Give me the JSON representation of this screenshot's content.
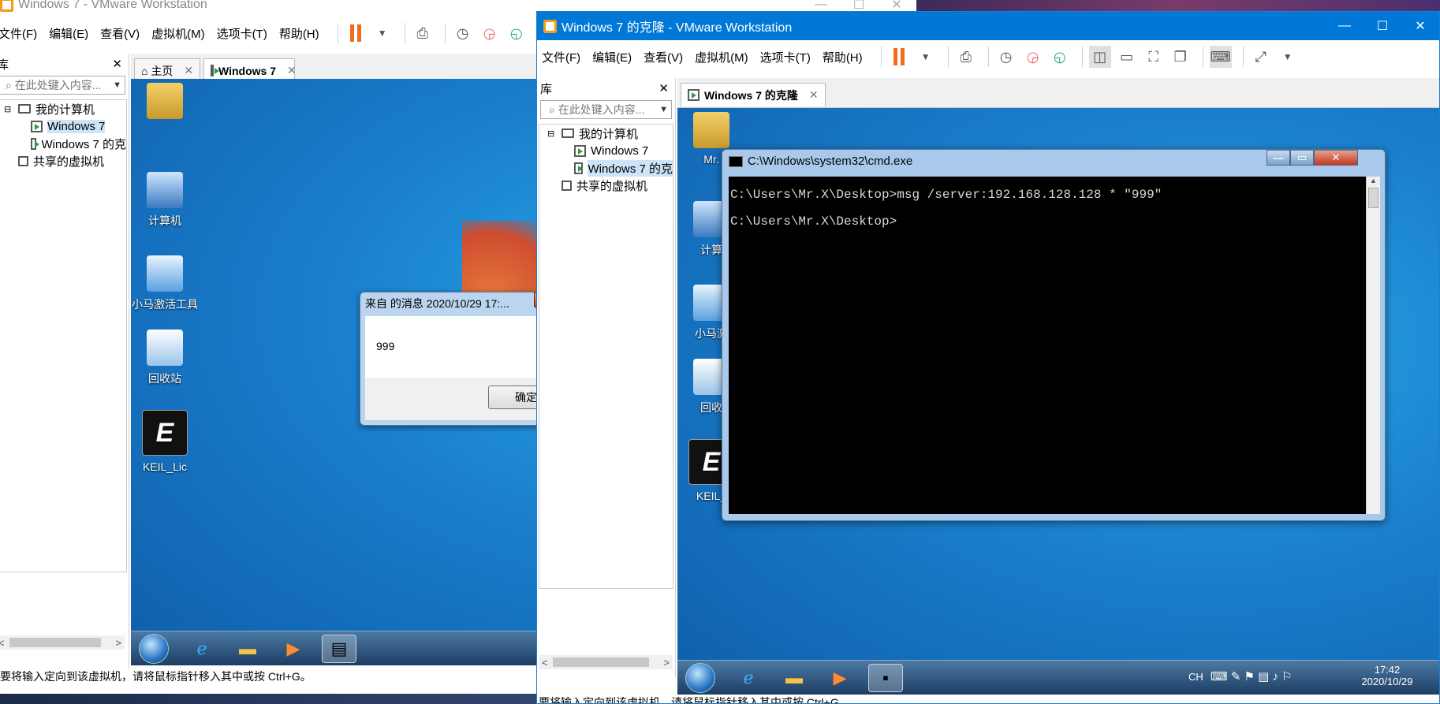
{
  "win1": {
    "title": "Windows 7 - VMware Workstation",
    "menu": [
      "文件(F)",
      "编辑(E)",
      "查看(V)",
      "虚拟机(M)",
      "选项卡(T)",
      "帮助(H)"
    ],
    "library": {
      "header": "库",
      "search_placeholder": "在此处键入内容...",
      "tree": {
        "root": "我的计算机",
        "vm1": "Windows 7",
        "vm2": "Windows 7 的克",
        "shared": "共享的虚拟机"
      }
    },
    "tabs": {
      "home": "主页",
      "vm": "Windows 7"
    },
    "desktop_icons": {
      "user": "",
      "computer": "计算机",
      "activator": "小马激活工具",
      "recycle": "回收站",
      "keil": "KEIL_Lic"
    },
    "message_box": {
      "title": "来自 的消息 2020/10/29 17:...",
      "body": "999",
      "ok": "确定"
    },
    "status": "要将输入定向到该虚拟机，请将鼠标指针移入其中或按 Ctrl+G。"
  },
  "win2": {
    "title": "Windows 7 的克隆 - VMware Workstation",
    "menu": [
      "文件(F)",
      "编辑(E)",
      "查看(V)",
      "虚拟机(M)",
      "选项卡(T)",
      "帮助(H)"
    ],
    "library": {
      "header": "库",
      "search_placeholder": "在此处键入内容...",
      "tree": {
        "root": "我的计算机",
        "vm1": "Windows 7",
        "vm2": "Windows 7 的克",
        "shared": "共享的虚拟机"
      }
    },
    "tabs": {
      "vm": "Windows 7 的克隆"
    },
    "desktop_icons": {
      "user": "Mr.",
      "computer": "计算",
      "activator": "小马激",
      "recycle": "回收",
      "keil": "KEIL_"
    },
    "cmd": {
      "title": "C:\\Windows\\system32\\cmd.exe",
      "line1": "C:\\Users\\Mr.X\\Desktop>msg /server:192.168.128.128 * \"999\"",
      "line2": "C:\\Users\\Mr.X\\Desktop>"
    },
    "tray": {
      "lang": "CH",
      "time": "17:42",
      "date": "2020/10/29"
    },
    "status": "要将输入定向到该虚拟机，请将鼠标指针移入其中或按 Ctrl+G。"
  },
  "colors": {
    "accent": "#f26b1d",
    "titlebar_active": "#0078d7",
    "desktop": "#1a7fce"
  }
}
